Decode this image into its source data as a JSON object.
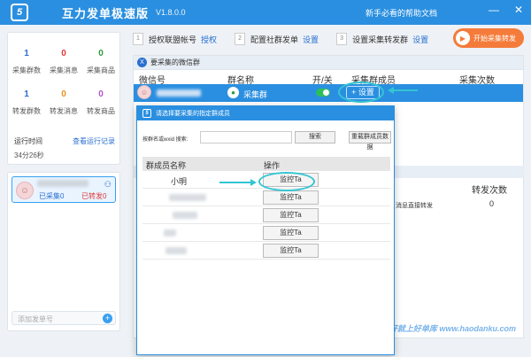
{
  "titlebar": {
    "logo": "5",
    "app_title": "互力发单极速版",
    "version": "V1.8.0.0",
    "help_link": "新手必看的帮助文档",
    "minimize": "—",
    "close": "✕"
  },
  "stats": {
    "row1": [
      {
        "value": "1",
        "label": "采集群数",
        "color": "#2a6fd0"
      },
      {
        "value": "0",
        "label": "采集消息",
        "color": "#e03a3a"
      },
      {
        "value": "0",
        "label": "采集商品",
        "color": "#2a9a3a"
      }
    ],
    "row2": [
      {
        "value": "1",
        "label": "转发群数",
        "color": "#2a6fd0"
      },
      {
        "value": "0",
        "label": "转发消息",
        "color": "#e6911f"
      },
      {
        "value": "0",
        "label": "转发商品",
        "color": "#b454c8"
      }
    ],
    "runtime_label": "运行时间",
    "runtime_value": "34分26秒",
    "run_log_link": "查看运行记录"
  },
  "account": {
    "collected": "已采集0",
    "forwarded": "已转发0",
    "add_placeholder": "添加发单号",
    "add_btn": "+"
  },
  "steps": [
    {
      "num": "1",
      "label": "授权联盟帐号",
      "link": "授权"
    },
    {
      "num": "2",
      "label": "配置社群发单",
      "link": "设置"
    },
    {
      "num": "3",
      "label": "设置采集转发群",
      "link": "设置"
    }
  ],
  "start_button": "开始采集转发",
  "collect_section": {
    "icon": "X",
    "title": "要采集的微信群",
    "columns": [
      "微信号",
      "群名称",
      "开/关",
      "采集群成员",
      "采集次数"
    ],
    "row": {
      "group_name": "采集群",
      "set_btn": "+ 设置"
    }
  },
  "forward_section": {
    "col_count": "转发次数",
    "row_text": "消息直接转发",
    "row_count": "0"
  },
  "watermark": "好就上好单库 www.haodanku.com",
  "modal": {
    "title": "请选择要采集的指定群成员",
    "search_label": "按群名或wxid 搜索:",
    "search_value": "",
    "search_btn": "搜索",
    "reload_btn": "重载群成员数据",
    "col_name": "群成员名称",
    "col_action": "操作",
    "first_member": "小明",
    "monitor_btn": "监控Ta"
  }
}
